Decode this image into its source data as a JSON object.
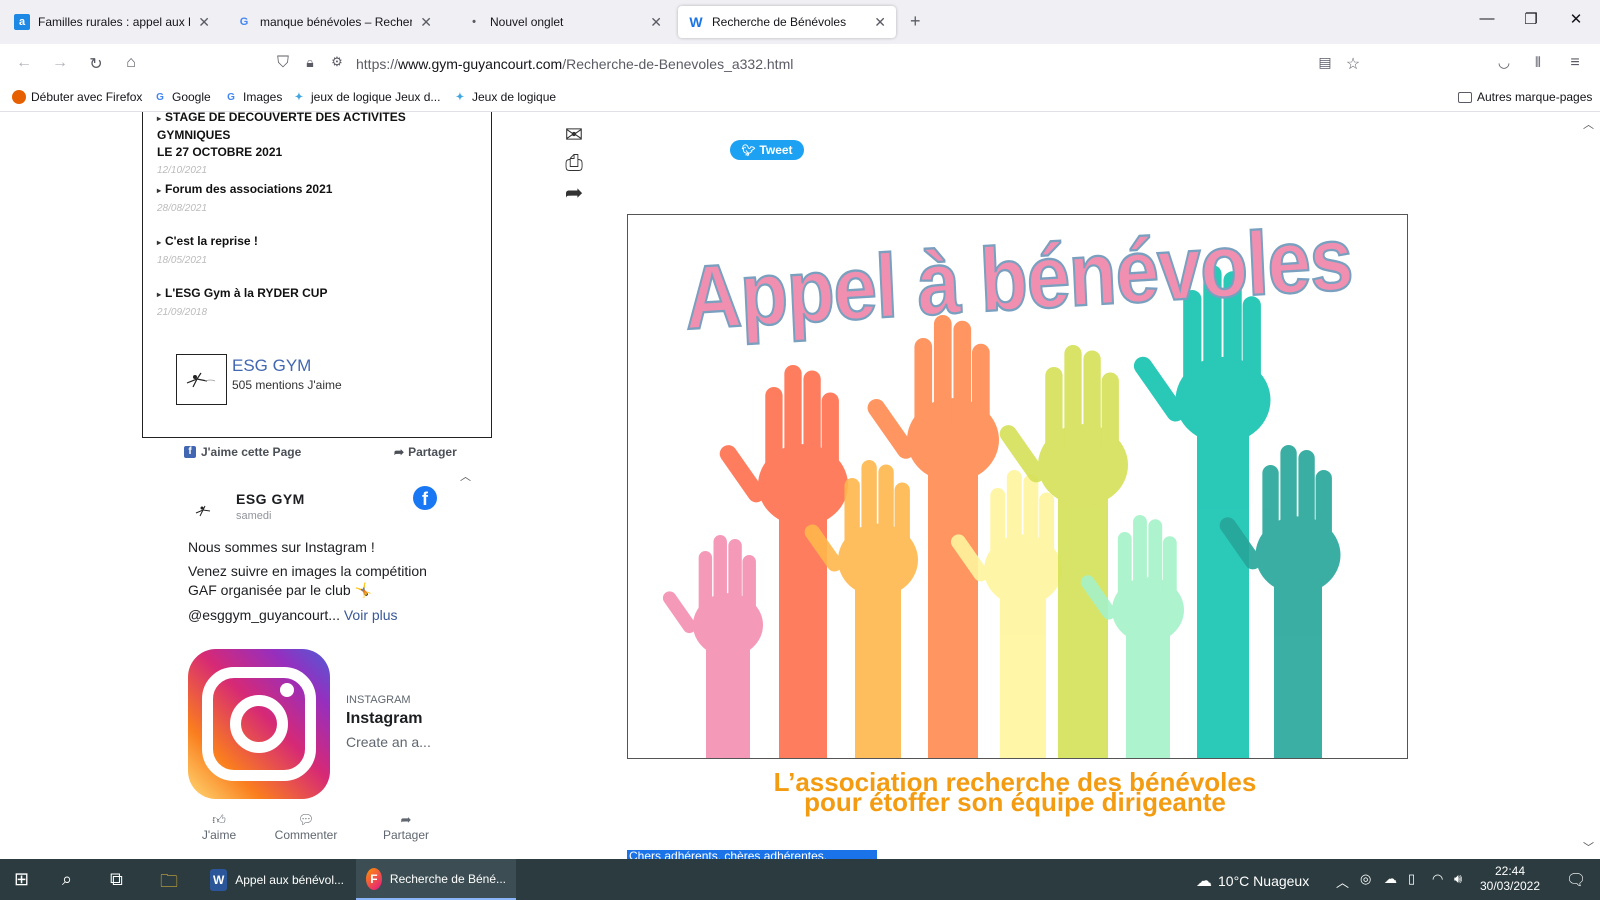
{
  "browser": {
    "tabs": [
      {
        "title": "Familles rurales : appel aux bén",
        "icon": "a",
        "active": false
      },
      {
        "title": "manque bénévoles – Recherche",
        "icon": "G",
        "active": false
      },
      {
        "title": "Nouvel onglet",
        "icon": "•",
        "active": false
      },
      {
        "title": "Recherche de Bénévoles",
        "icon": "W",
        "active": true
      }
    ],
    "new_tab": "+",
    "window_controls": {
      "minimize": "—",
      "restore": "❐",
      "close": "✕"
    },
    "url": {
      "scheme": "https://",
      "host": "www.gym-guyancourt.com",
      "path": "/Recherche-de-Benevoles_a332.html"
    },
    "bookmarks": [
      {
        "label": "Débuter avec Firefox",
        "color": "#e66000"
      },
      {
        "label": "Google",
        "color": "#4285f4"
      },
      {
        "label": "Images",
        "color": "#4285f4"
      },
      {
        "label": "jeux de logique Jeux d...",
        "color": "#3ea6e0"
      },
      {
        "label": "Jeux de logique",
        "color": "#3ea6e0"
      }
    ],
    "other_bookmarks": "Autres marque-pages"
  },
  "news": [
    {
      "title": "STAGE DE DECOUVERTE DES ACTIVITES GYMNIQUES",
      "title2": "LE 27 OCTOBRE 2021",
      "date": "12/10/2021"
    },
    {
      "title": "Forum des associations 2021",
      "date": "28/08/2021"
    },
    {
      "title": "C'est la reprise !",
      "date": "18/05/2021"
    },
    {
      "title": "L'ESG Gym à la RYDER CUP",
      "date": "21/09/2018"
    }
  ],
  "facebook": {
    "page_name": "ESG GYM",
    "likes": "505 mentions J'aime",
    "like_button": "J'aime cette Page",
    "share_button": "Partager",
    "post": {
      "author": "ESG GYM",
      "time": "samedi",
      "line1": "Nous sommes sur Instagram !",
      "line2": "Venez suivre en images la compétition",
      "line3": "GAF organisée par le club 🤸",
      "line4": "@esggym_guyancourt...",
      "see_more": "Voir plus"
    },
    "link": {
      "source": "INSTAGRAM",
      "title": "Instagram",
      "desc": "Create an a..."
    },
    "actions": {
      "like": "J'aime",
      "comment": "Commenter",
      "share": "Partager"
    }
  },
  "tweet": "Tweet",
  "hero": {
    "title": "Appel à bénévoles",
    "hand_colors": [
      "#f48fb1",
      "#ff6f4e",
      "#ffb74d",
      "#ff8a50",
      "#fff59d",
      "#d4e157",
      "#a5f2c8",
      "#14c3b0",
      "#26a69a"
    ]
  },
  "subtitle": {
    "line1": "L’association recherche des bénévoles",
    "line2": "pour étoffer son équipe dirigeante"
  },
  "highlight": "Chers adhérents, chères adhérentes,",
  "taskbar": {
    "apps": [
      {
        "label": "Appel aux bénévol...",
        "icon": "W",
        "active": false
      },
      {
        "label": "Recherche de Béné...",
        "icon": "F",
        "active": true
      }
    ],
    "weather": "10°C  Nuageux",
    "time": "22:44",
    "date": "30/03/2022"
  }
}
